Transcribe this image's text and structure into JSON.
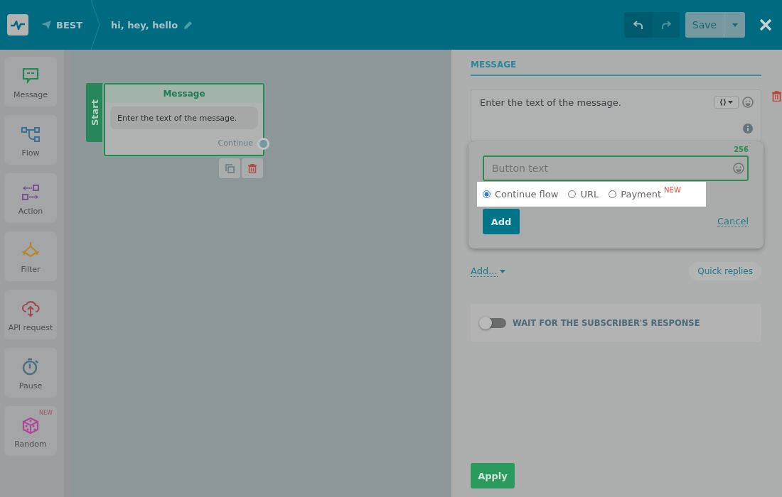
{
  "header": {
    "bot_name": "BEST",
    "flow_name": "hi, hey, hello",
    "save_label": "Save"
  },
  "tools": [
    {
      "label": "Message",
      "kind": "message"
    },
    {
      "label": "Flow",
      "kind": "flow"
    },
    {
      "label": "Action",
      "kind": "action"
    },
    {
      "label": "Filter",
      "kind": "filter"
    },
    {
      "label": "API request",
      "kind": "api"
    },
    {
      "label": "Pause",
      "kind": "pause"
    },
    {
      "label": "Random",
      "kind": "random",
      "badge": "NEW"
    }
  ],
  "canvas": {
    "start_label": "Start",
    "node": {
      "title": "Message",
      "text": "Enter the text of the message.",
      "output": "Continue"
    }
  },
  "panel": {
    "heading": "MESSAGE",
    "message_text": "Enter the text of the message.",
    "button_editor": {
      "counter": "256",
      "placeholder": "Button text",
      "options": [
        {
          "label": "Continue flow",
          "selected": true
        },
        {
          "label": "URL",
          "selected": false
        },
        {
          "label": "Payment",
          "selected": false,
          "badge": "NEW"
        }
      ],
      "add_label": "Add",
      "cancel_label": "Cancel"
    },
    "add_menu": "Add...",
    "quick_replies": "Quick replies",
    "wait_toggle": {
      "label": "WAIT FOR THE SUBSCRIBER'S RESPONSE",
      "on": false
    },
    "apply_label": "Apply"
  }
}
